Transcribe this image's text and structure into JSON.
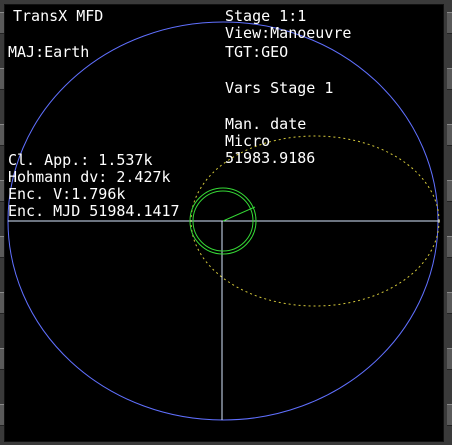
{
  "header": {
    "title": "TransX MFD",
    "stage": "Stage 1:1",
    "view": "View:Manoeuvre",
    "major": "MAJ:Earth",
    "target": "TGT:GEO"
  },
  "vars": {
    "heading": "Vars Stage 1",
    "man_date_label": "Man. date",
    "man_date_mode": "Micro",
    "man_date_value": "51983.9186"
  },
  "readouts": {
    "closest_approach": "Cl. App.: 1.537k",
    "hohmann_dv": "Hohmann dv: 2.427k",
    "encounter_velocity": "Enc. V:1.796k",
    "encounter_mjd": "Enc. MJD 51984.1417"
  },
  "colors": {
    "background": "#000000",
    "frame": "#3a3a3a",
    "text": "#ffffff",
    "target_orbit": "#6070ff",
    "ship_orbit": "#d4c83a",
    "planet": "#36d936",
    "axis": "#d8e8ff"
  }
}
